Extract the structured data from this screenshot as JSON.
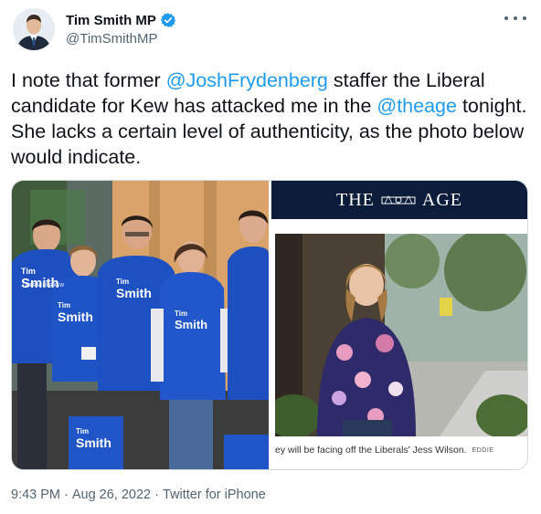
{
  "author": {
    "display_name": "Tim Smith MP",
    "handle": "@TimSmithMP",
    "avatar_icon": "person-avatar-icon",
    "verified_icon": "verified-badge-icon",
    "verified_color": "#1d9bf0"
  },
  "more_icon": "more-options-icon",
  "tweet": {
    "text_1": "I note that former ",
    "mention_1": "@JoshFrydenberg",
    "text_2": " staffer the Liberal candidate for Kew has attacked me in the ",
    "mention_2": "@theage",
    "text_3": " tonight. She lacks a certain level of authenticity, as the photo below would indicate.",
    "mention_color": "#1d9bf0"
  },
  "media": {
    "left_photo": {
      "shirt_texts": [
        "Tim",
        "Smith",
        "Tim",
        "Smith",
        "Tim",
        "Smith",
        "Tim",
        "Smith",
        "Tim",
        "Smith"
      ],
      "small_text": "LIBERAL FOR KEW"
    },
    "right_photo": {
      "masthead_left": "THE",
      "masthead_right": "AGE",
      "caption": "ey will be facing off the Liberals' Jess Wilson.",
      "caption_credit": "EDDIE"
    }
  },
  "footer": {
    "time": "9:43 PM",
    "sep_1": "·",
    "date": "Aug 26, 2022",
    "sep_2": "·",
    "source": "Twitter for iPhone"
  }
}
